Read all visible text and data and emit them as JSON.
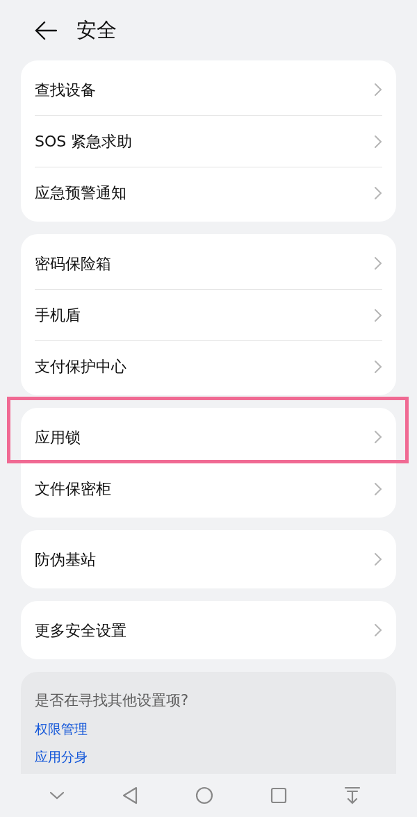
{
  "header": {
    "title": "安全"
  },
  "groups": [
    {
      "items": [
        {
          "label": "查找设备",
          "highlighted": false
        },
        {
          "label": "SOS 紧急求助",
          "highlighted": false
        },
        {
          "label": "应急预警通知",
          "highlighted": false
        }
      ]
    },
    {
      "items": [
        {
          "label": "密码保险箱",
          "highlighted": false
        },
        {
          "label": "手机盾",
          "highlighted": false
        },
        {
          "label": "支付保护中心",
          "highlighted": false
        }
      ]
    },
    {
      "items": [
        {
          "label": "应用锁",
          "highlighted": true
        },
        {
          "label": "文件保密柜",
          "highlighted": false
        }
      ]
    },
    {
      "items": [
        {
          "label": "防伪基站",
          "highlighted": false
        }
      ]
    },
    {
      "items": [
        {
          "label": "更多安全设置",
          "highlighted": false
        }
      ]
    }
  ],
  "suggestions": {
    "title": "是否在寻找其他设置项?",
    "links": [
      "权限管理",
      "应用分身"
    ]
  }
}
